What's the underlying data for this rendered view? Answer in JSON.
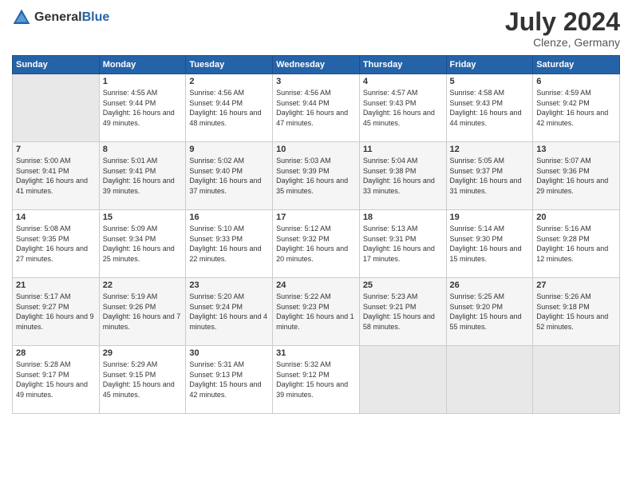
{
  "header": {
    "logo_general": "General",
    "logo_blue": "Blue",
    "month_year": "July 2024",
    "location": "Clenze, Germany"
  },
  "days_of_week": [
    "Sunday",
    "Monday",
    "Tuesday",
    "Wednesday",
    "Thursday",
    "Friday",
    "Saturday"
  ],
  "weeks": [
    {
      "days": [
        {
          "number": "",
          "empty": true
        },
        {
          "number": "1",
          "sunrise": "4:55 AM",
          "sunset": "9:44 PM",
          "daylight": "16 hours and 49 minutes."
        },
        {
          "number": "2",
          "sunrise": "4:56 AM",
          "sunset": "9:44 PM",
          "daylight": "16 hours and 48 minutes."
        },
        {
          "number": "3",
          "sunrise": "4:56 AM",
          "sunset": "9:44 PM",
          "daylight": "16 hours and 47 minutes."
        },
        {
          "number": "4",
          "sunrise": "4:57 AM",
          "sunset": "9:43 PM",
          "daylight": "16 hours and 45 minutes."
        },
        {
          "number": "5",
          "sunrise": "4:58 AM",
          "sunset": "9:43 PM",
          "daylight": "16 hours and 44 minutes."
        },
        {
          "number": "6",
          "sunrise": "4:59 AM",
          "sunset": "9:42 PM",
          "daylight": "16 hours and 42 minutes."
        }
      ]
    },
    {
      "days": [
        {
          "number": "7",
          "sunrise": "5:00 AM",
          "sunset": "9:41 PM",
          "daylight": "16 hours and 41 minutes."
        },
        {
          "number": "8",
          "sunrise": "5:01 AM",
          "sunset": "9:41 PM",
          "daylight": "16 hours and 39 minutes."
        },
        {
          "number": "9",
          "sunrise": "5:02 AM",
          "sunset": "9:40 PM",
          "daylight": "16 hours and 37 minutes."
        },
        {
          "number": "10",
          "sunrise": "5:03 AM",
          "sunset": "9:39 PM",
          "daylight": "16 hours and 35 minutes."
        },
        {
          "number": "11",
          "sunrise": "5:04 AM",
          "sunset": "9:38 PM",
          "daylight": "16 hours and 33 minutes."
        },
        {
          "number": "12",
          "sunrise": "5:05 AM",
          "sunset": "9:37 PM",
          "daylight": "16 hours and 31 minutes."
        },
        {
          "number": "13",
          "sunrise": "5:07 AM",
          "sunset": "9:36 PM",
          "daylight": "16 hours and 29 minutes."
        }
      ]
    },
    {
      "days": [
        {
          "number": "14",
          "sunrise": "5:08 AM",
          "sunset": "9:35 PM",
          "daylight": "16 hours and 27 minutes."
        },
        {
          "number": "15",
          "sunrise": "5:09 AM",
          "sunset": "9:34 PM",
          "daylight": "16 hours and 25 minutes."
        },
        {
          "number": "16",
          "sunrise": "5:10 AM",
          "sunset": "9:33 PM",
          "daylight": "16 hours and 22 minutes."
        },
        {
          "number": "17",
          "sunrise": "5:12 AM",
          "sunset": "9:32 PM",
          "daylight": "16 hours and 20 minutes."
        },
        {
          "number": "18",
          "sunrise": "5:13 AM",
          "sunset": "9:31 PM",
          "daylight": "16 hours and 17 minutes."
        },
        {
          "number": "19",
          "sunrise": "5:14 AM",
          "sunset": "9:30 PM",
          "daylight": "16 hours and 15 minutes."
        },
        {
          "number": "20",
          "sunrise": "5:16 AM",
          "sunset": "9:28 PM",
          "daylight": "16 hours and 12 minutes."
        }
      ]
    },
    {
      "days": [
        {
          "number": "21",
          "sunrise": "5:17 AM",
          "sunset": "9:27 PM",
          "daylight": "16 hours and 9 minutes."
        },
        {
          "number": "22",
          "sunrise": "5:19 AM",
          "sunset": "9:26 PM",
          "daylight": "16 hours and 7 minutes."
        },
        {
          "number": "23",
          "sunrise": "5:20 AM",
          "sunset": "9:24 PM",
          "daylight": "16 hours and 4 minutes."
        },
        {
          "number": "24",
          "sunrise": "5:22 AM",
          "sunset": "9:23 PM",
          "daylight": "16 hours and 1 minute."
        },
        {
          "number": "25",
          "sunrise": "5:23 AM",
          "sunset": "9:21 PM",
          "daylight": "15 hours and 58 minutes."
        },
        {
          "number": "26",
          "sunrise": "5:25 AM",
          "sunset": "9:20 PM",
          "daylight": "15 hours and 55 minutes."
        },
        {
          "number": "27",
          "sunrise": "5:26 AM",
          "sunset": "9:18 PM",
          "daylight": "15 hours and 52 minutes."
        }
      ]
    },
    {
      "days": [
        {
          "number": "28",
          "sunrise": "5:28 AM",
          "sunset": "9:17 PM",
          "daylight": "15 hours and 49 minutes."
        },
        {
          "number": "29",
          "sunrise": "5:29 AM",
          "sunset": "9:15 PM",
          "daylight": "15 hours and 45 minutes."
        },
        {
          "number": "30",
          "sunrise": "5:31 AM",
          "sunset": "9:13 PM",
          "daylight": "15 hours and 42 minutes."
        },
        {
          "number": "31",
          "sunrise": "5:32 AM",
          "sunset": "9:12 PM",
          "daylight": "15 hours and 39 minutes."
        },
        {
          "number": "",
          "empty": true
        },
        {
          "number": "",
          "empty": true
        },
        {
          "number": "",
          "empty": true
        }
      ]
    }
  ]
}
